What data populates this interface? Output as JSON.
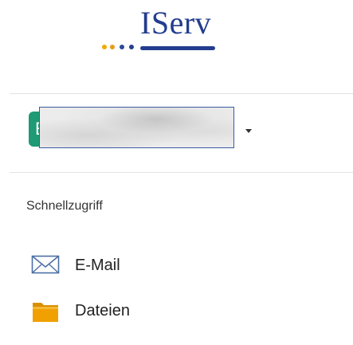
{
  "brand": {
    "name": "IServ",
    "text_color": "#233d8e",
    "dot_colors": [
      "#f2a900",
      "#e89b1a",
      "#2c4a9a",
      "#23408e"
    ],
    "bar_color": "#233d8e"
  },
  "user": {
    "avatar_letter": "E",
    "avatar_color": "#1e9a74",
    "name_visible_fragment": "n",
    "menu_icon": "caret-down-icon",
    "redaction_border_color": "#3b5aa0"
  },
  "quick_access": {
    "title": "Schnellzugriff",
    "items": [
      {
        "label": "E-Mail",
        "icon": "envelope-icon",
        "icon_color": "#4a6fa5"
      },
      {
        "label": "Dateien",
        "icon": "folder-icon",
        "icon_color": "#f0a000"
      }
    ]
  },
  "colors": {
    "divider": "#e3e3e3",
    "text": "#333333"
  }
}
